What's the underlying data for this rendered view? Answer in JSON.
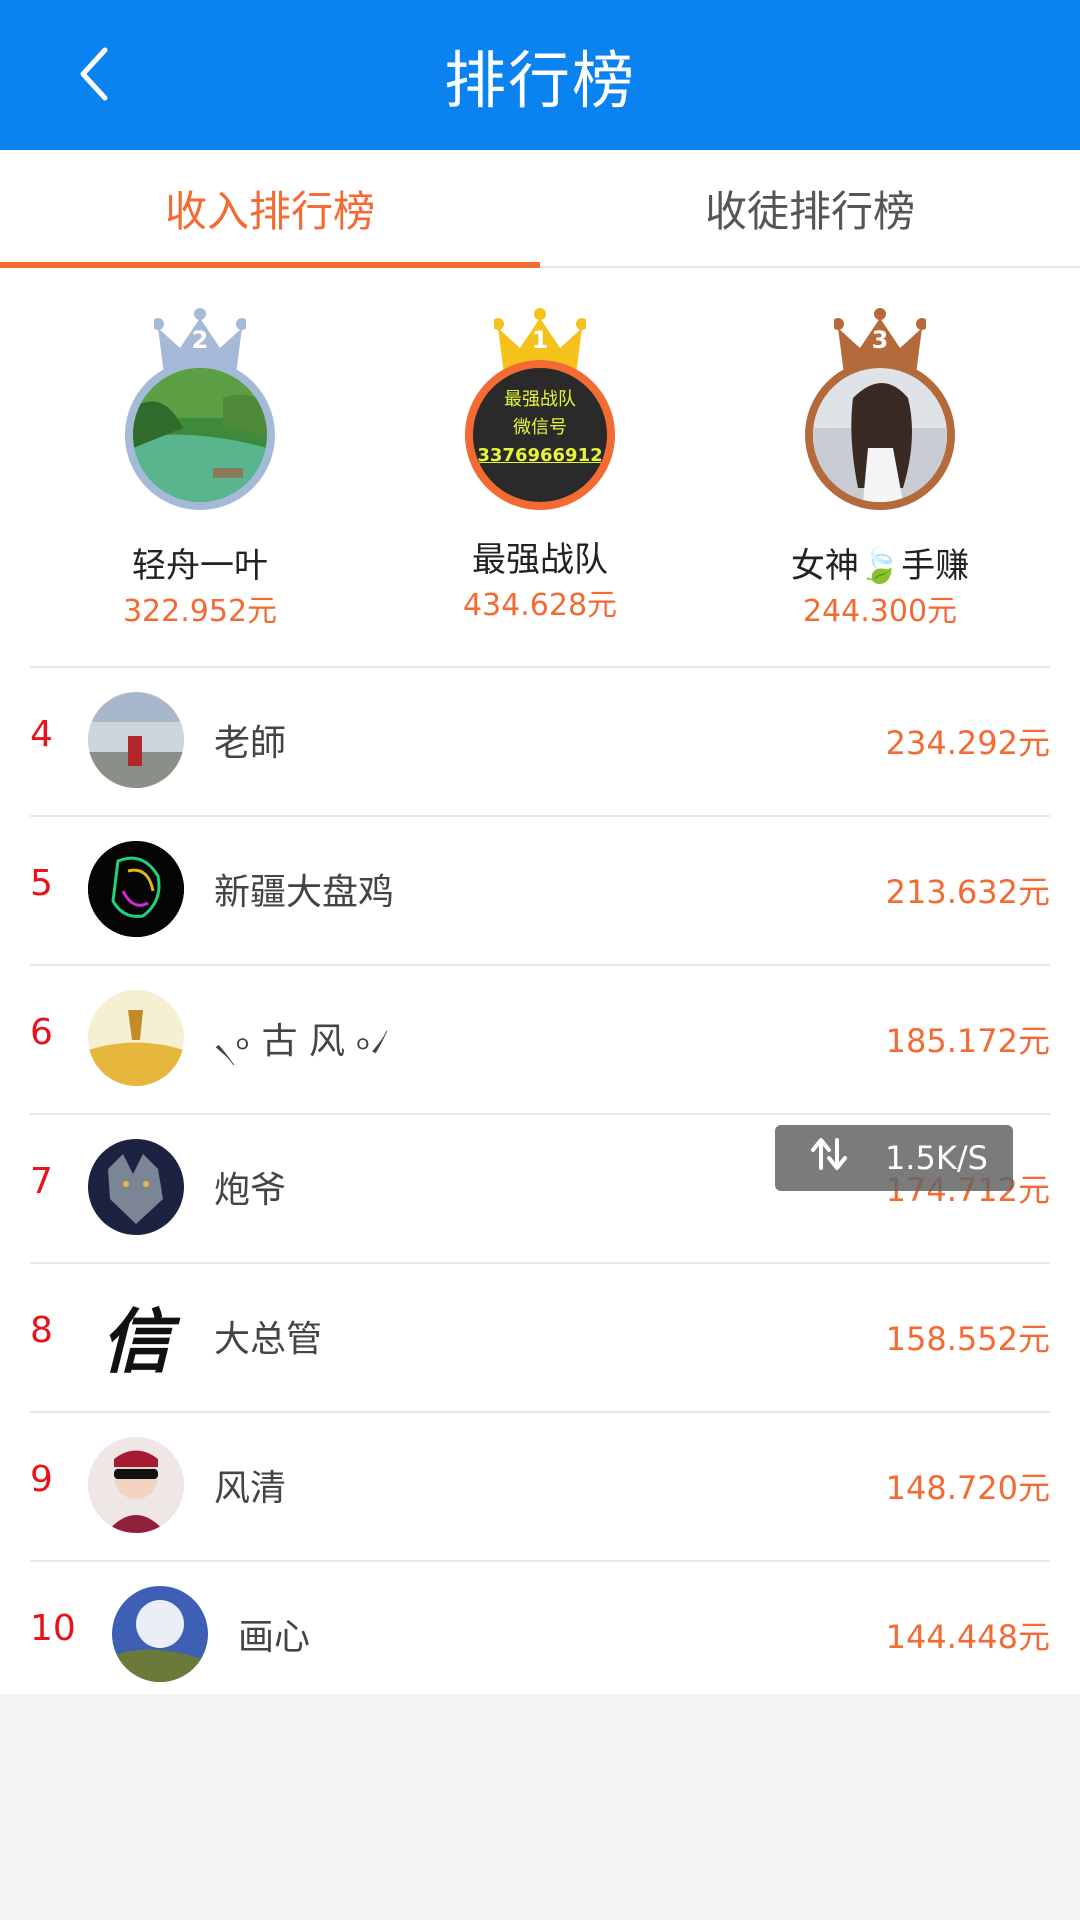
{
  "header": {
    "title": "排行榜",
    "back_icon": "back-arrow-icon"
  },
  "tabs": [
    {
      "label": "收入排行榜",
      "active": true
    },
    {
      "label": "收徒排行榜",
      "active": false
    }
  ],
  "podium": [
    {
      "rank": "2",
      "name": "轻舟一叶",
      "money": "322.952元",
      "crown_color": "#a5b9d8"
    },
    {
      "rank": "1",
      "name": "最强战队",
      "money": "434.628元",
      "crown_color": "#f5c21b",
      "avatar_text": [
        "最强战队",
        "微信号",
        "3376966912"
      ]
    },
    {
      "rank": "3",
      "name": "女神🍃手赚",
      "money": "244.300元",
      "crown_color": "#b46a3a"
    }
  ],
  "list": [
    {
      "rank": "4",
      "name": "老師",
      "money": "234.292元"
    },
    {
      "rank": "5",
      "name": "新疆大盘鸡",
      "money": "213.632元"
    },
    {
      "rank": "6",
      "name": "৲৹ 古 风 ৹৴",
      "money": "185.172元"
    },
    {
      "rank": "7",
      "name": "炮爷",
      "money": "174.712元"
    },
    {
      "rank": "8",
      "name": "大总管",
      "money": "158.552元",
      "avatar_text": "信"
    },
    {
      "rank": "9",
      "name": "风清",
      "money": "148.720元"
    },
    {
      "rank": "10",
      "name": "画心",
      "money": "144.448元"
    }
  ],
  "toast": {
    "text": "1.5K/S",
    "icon": "transfer-arrows-icon"
  }
}
